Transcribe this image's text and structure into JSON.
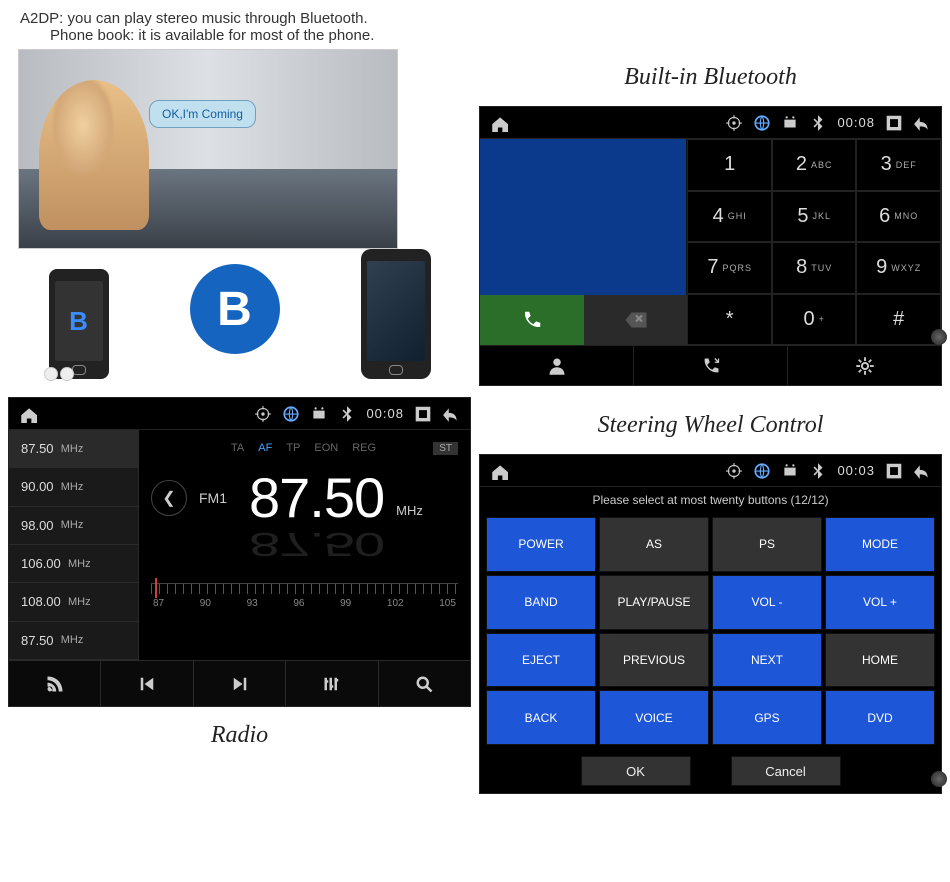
{
  "description": {
    "line1": "A2DP: you can play stereo music through Bluetooth.",
    "line2": "Phone book: it is available for most of the phone."
  },
  "photo": {
    "speech_text": "OK,I'm Coming",
    "badge_small": "B",
    "badge_big": "B"
  },
  "titles": {
    "bluetooth": "Built-in Bluetooth",
    "radio": "Radio",
    "swc": "Steering Wheel Control"
  },
  "bluetooth": {
    "clock": "00:08",
    "keypad": [
      {
        "n": "1",
        "s": ""
      },
      {
        "n": "2",
        "s": "ABC"
      },
      {
        "n": "3",
        "s": "DEF"
      },
      {
        "n": "4",
        "s": "GHI"
      },
      {
        "n": "5",
        "s": "JKL"
      },
      {
        "n": "6",
        "s": "MNO"
      },
      {
        "n": "7",
        "s": "PQRS"
      },
      {
        "n": "8",
        "s": "TUV"
      },
      {
        "n": "9",
        "s": "WXYZ"
      },
      {
        "n": "*",
        "s": ""
      },
      {
        "n": "0",
        "s": "+"
      },
      {
        "n": "#",
        "s": ""
      }
    ]
  },
  "radio": {
    "clock": "00:08",
    "flags": {
      "ta": "TA",
      "af": "AF",
      "tp": "TP",
      "eon": "EON",
      "reg": "REG",
      "st": "ST"
    },
    "band": "FM1",
    "frequency": "87.50",
    "unit": "MHz",
    "presets": [
      {
        "f": "87.50",
        "u": "MHz"
      },
      {
        "f": "90.00",
        "u": "MHz"
      },
      {
        "f": "98.00",
        "u": "MHz"
      },
      {
        "f": "106.00",
        "u": "MHz"
      },
      {
        "f": "108.00",
        "u": "MHz"
      },
      {
        "f": "87.50",
        "u": "MHz"
      }
    ],
    "ruler_labels": [
      "87",
      "90",
      "93",
      "96",
      "99",
      "102",
      "105"
    ]
  },
  "swc": {
    "clock": "00:03",
    "hint": "Please select at most twenty buttons (12/12)",
    "buttons": [
      {
        "l": "POWER",
        "c": "blue"
      },
      {
        "l": "AS",
        "c": ""
      },
      {
        "l": "PS",
        "c": ""
      },
      {
        "l": "MODE",
        "c": "blue"
      },
      {
        "l": "BAND",
        "c": "blue"
      },
      {
        "l": "PLAY/PAUSE",
        "c": ""
      },
      {
        "l": "VOL -",
        "c": "blue"
      },
      {
        "l": "VOL +",
        "c": "blue"
      },
      {
        "l": "EJECT",
        "c": "blue"
      },
      {
        "l": "PREVIOUS",
        "c": ""
      },
      {
        "l": "NEXT",
        "c": "blue"
      },
      {
        "l": "HOME",
        "c": ""
      },
      {
        "l": "BACK",
        "c": "blue"
      },
      {
        "l": "VOICE",
        "c": "blue"
      },
      {
        "l": "GPS",
        "c": "blue"
      },
      {
        "l": "DVD",
        "c": "blue"
      }
    ],
    "ok": "OK",
    "cancel": "Cancel"
  }
}
